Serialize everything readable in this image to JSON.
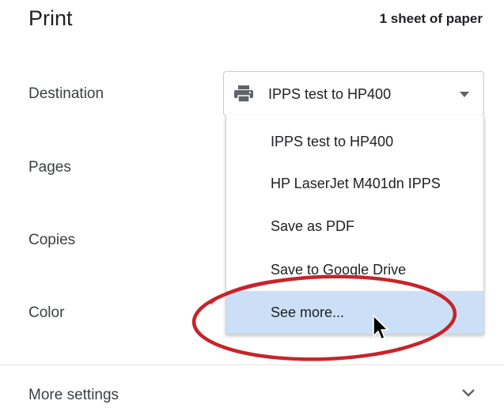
{
  "header": {
    "title": "Print",
    "sheet_count": "1 sheet of paper"
  },
  "settings": {
    "destination_label": "Destination",
    "pages_label": "Pages",
    "copies_label": "Copies",
    "color_label": "Color",
    "more_settings_label": "More settings"
  },
  "destination": {
    "selected": "IPPS test to HP400",
    "icon": "printer-icon",
    "options": [
      "IPPS test to HP400",
      "HP LaserJet M401dn IPPS",
      "Save as PDF",
      "Save to Google Drive",
      "See more..."
    ],
    "highlighted_option": "See more..."
  },
  "colors": {
    "highlight": "#cbe0f7",
    "annotation": "#c8232a",
    "text": "#202124"
  }
}
